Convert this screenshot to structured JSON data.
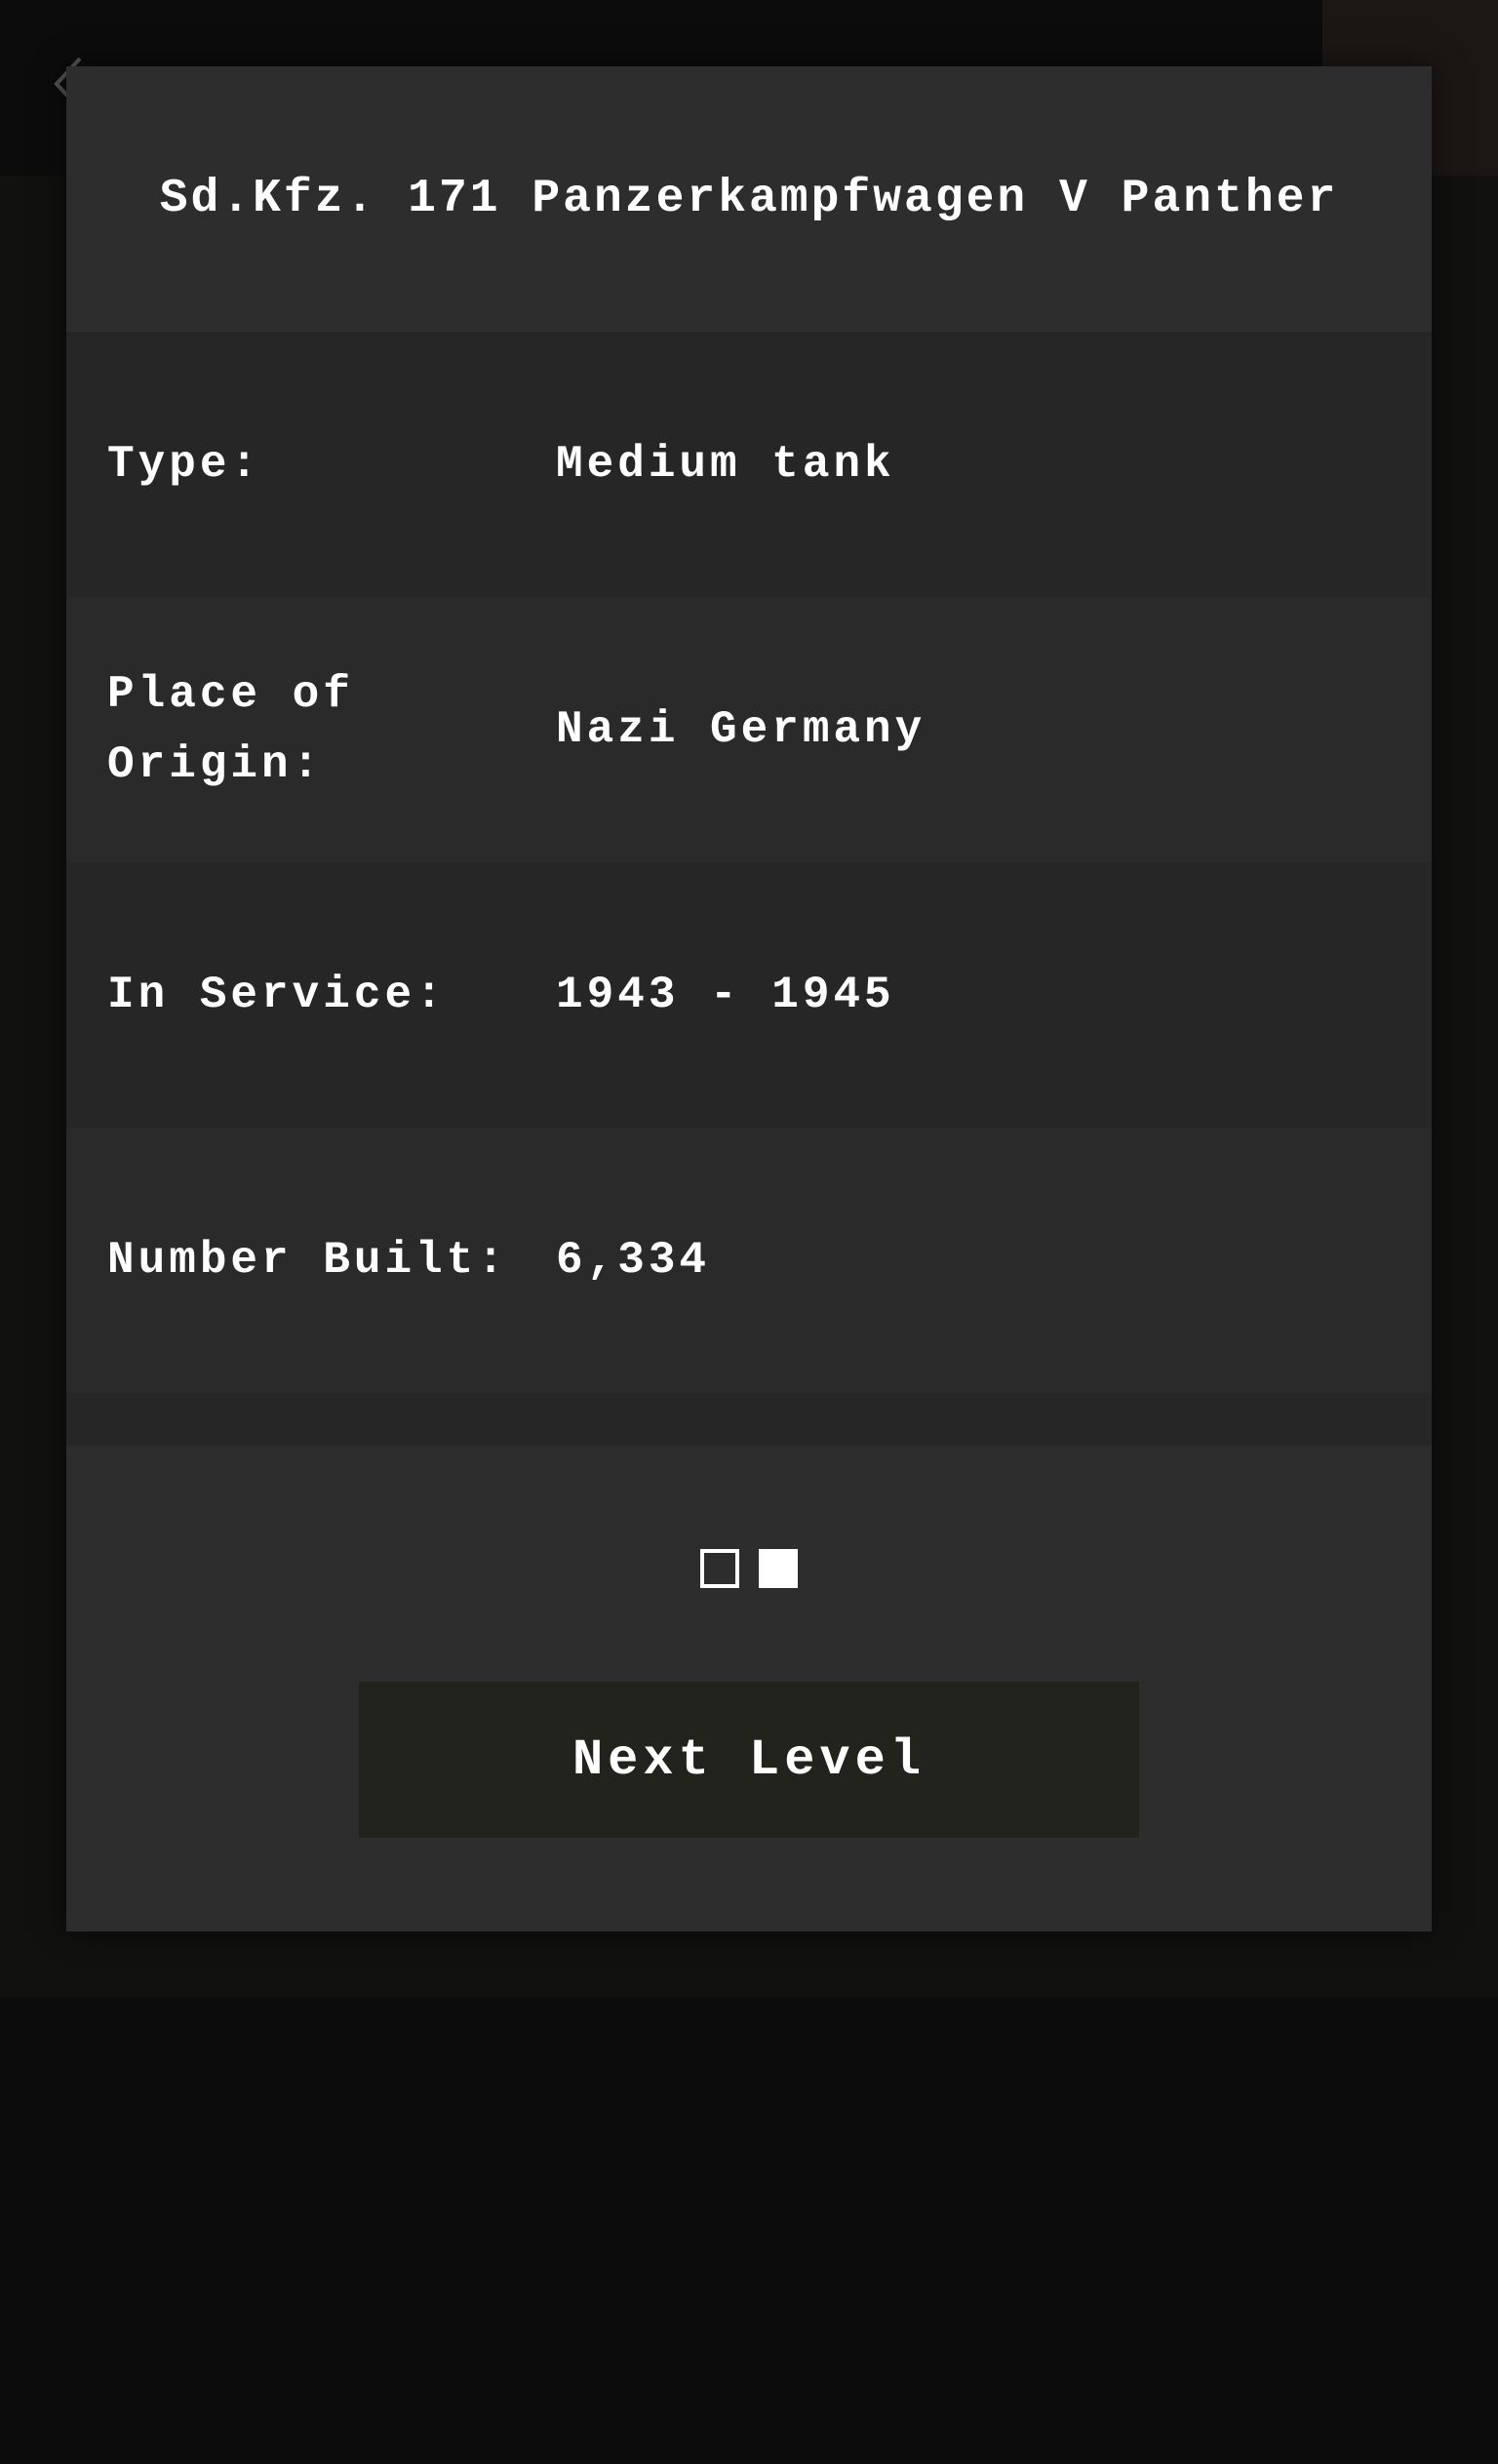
{
  "navigation": {
    "back_icon": "chevron-left-icon"
  },
  "card": {
    "title": "Sd.Kfz. 171 Panzerkampfwagen V Panther",
    "rows": [
      {
        "label": "Type:",
        "value": "Medium tank"
      },
      {
        "label": "Place of Origin:",
        "value": "Nazi Germany"
      },
      {
        "label": "In Service:",
        "value": "1943 - 1945"
      },
      {
        "label": "Number Built:",
        "value": "6,334"
      }
    ]
  },
  "pagination": {
    "total_pages": 2,
    "current_page": 2,
    "dots": [
      {
        "state": "inactive"
      },
      {
        "state": "active"
      }
    ]
  },
  "actions": {
    "next_level_label": "Next Level"
  },
  "colors": {
    "background": "#0c0c0c",
    "card": "#2d2d2d",
    "row_dark": "#262626",
    "row_light": "#2a2a2a",
    "button": "#22231c",
    "text": "#ffffff"
  }
}
